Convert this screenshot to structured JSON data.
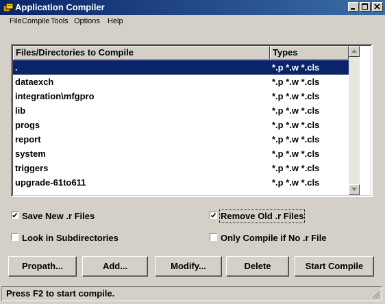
{
  "window": {
    "title": "Application Compiler"
  },
  "menu": [
    "File",
    "Compile",
    "Tools",
    "Options",
    "Help"
  ],
  "list": {
    "headers": {
      "files": "Files/Directories to Compile",
      "types": "Types"
    },
    "rows": [
      {
        "path": ".",
        "types": "*.p *.w *.cls",
        "selected": true
      },
      {
        "path": "dataexch",
        "types": "*.p *.w *.cls"
      },
      {
        "path": "integration\\mfgpro",
        "types": "*.p *.w *.cls"
      },
      {
        "path": "lib",
        "types": "*.p *.w *.cls"
      },
      {
        "path": "progs",
        "types": "*.p *.w *.cls"
      },
      {
        "path": "report",
        "types": "*.p *.w *.cls"
      },
      {
        "path": "system",
        "types": "*.p *.w *.cls"
      },
      {
        "path": "triggers",
        "types": "*.p *.w *.cls"
      },
      {
        "path": "upgrade-61to611",
        "types": "*.p *.w *.cls"
      }
    ]
  },
  "options": {
    "save_new_r": {
      "label": "Save New .r Files",
      "checked": true
    },
    "remove_old_r": {
      "label": "Remove Old .r Files",
      "checked": true
    },
    "look_in_subdirs": {
      "label": "Look in Subdirectories",
      "checked": false
    },
    "only_compile_if_no_r": {
      "label": "Only Compile if No .r File",
      "checked": false
    }
  },
  "buttons": {
    "propath": "Propath...",
    "add": "Add...",
    "modify": "Modify...",
    "delete": "Delete",
    "start_compile": "Start Compile"
  },
  "status": "Press F2 to start compile.",
  "colors": {
    "titlebar": "#0a246a",
    "selection": "#0a246a",
    "face": "#d4d0c8"
  }
}
